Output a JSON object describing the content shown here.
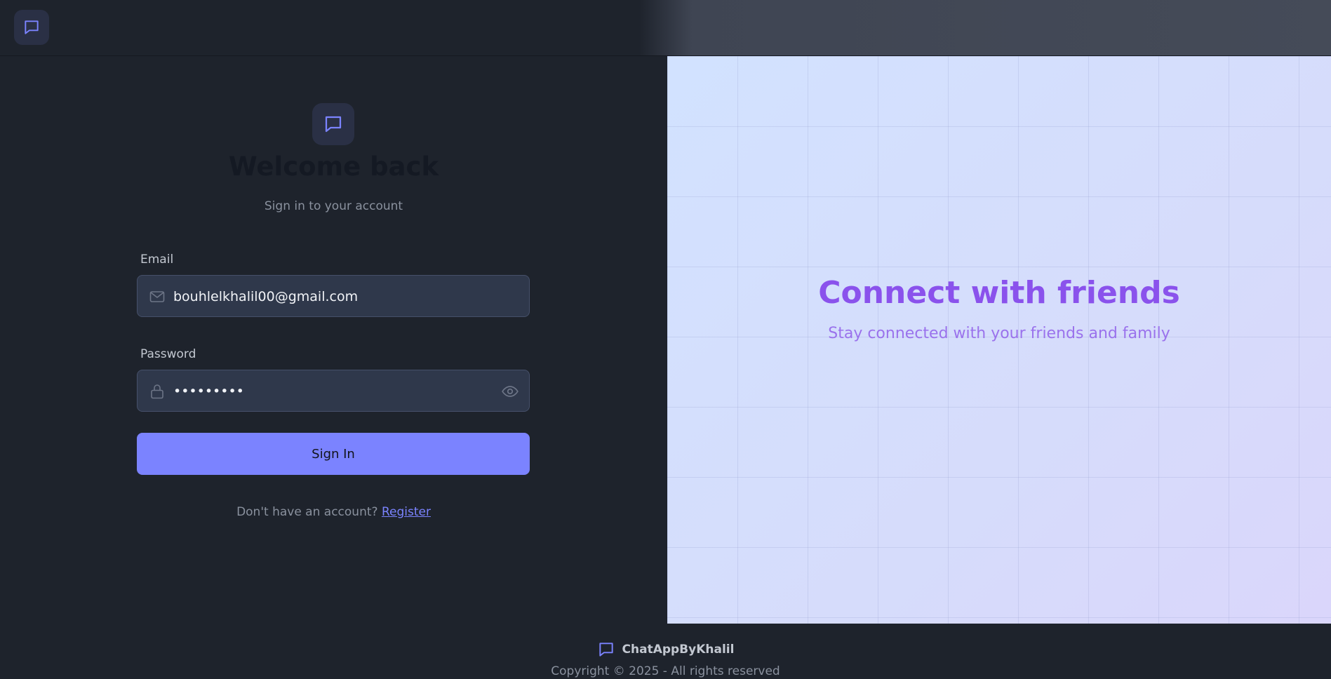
{
  "header": {
    "logo_icon": "chat-bubble-icon"
  },
  "login": {
    "logo_icon": "chat-bubble-icon",
    "title": "Welcome back",
    "subtitle": "Sign in to your account",
    "email": {
      "label": "Email",
      "value": "bouhlelkhalil00@gmail.com",
      "icon": "mail-icon"
    },
    "password": {
      "label": "Password",
      "value": "•••••••••",
      "icon": "lock-icon",
      "toggle_icon": "eye-icon"
    },
    "submit_label": "Sign In",
    "register_prompt": "Don't have an account?",
    "register_link": "Register"
  },
  "promo": {
    "title": "Connect with friends",
    "subtitle": "Stay connected with your friends and family"
  },
  "footer": {
    "brand_icon": "chat-bubble-icon",
    "brand": "ChatAppByKhalil",
    "copyright": "Copyright © 2025 - All rights reserved"
  },
  "colors": {
    "accent": "#7b83ff",
    "promo_heading": "#8a52ec",
    "background": "#1e232c"
  }
}
